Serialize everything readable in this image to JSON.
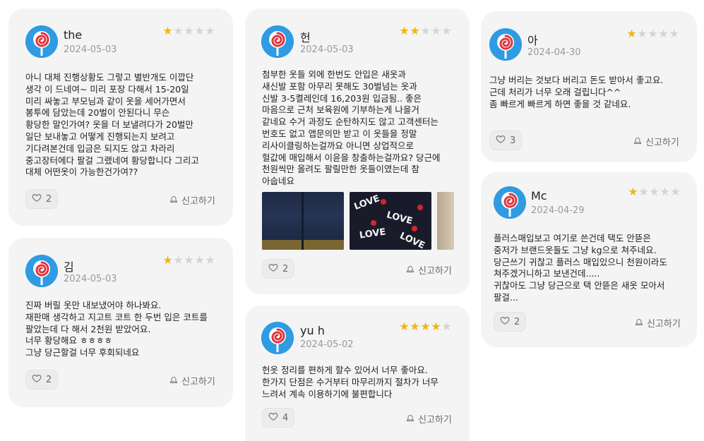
{
  "colors": {
    "accent_star": "#f2b611",
    "star_off": "#d4d4d4",
    "card_bg": "#f4f4f5",
    "avatar_bg": "#2e9be3"
  },
  "reviews": [
    {
      "user": "the",
      "date": "2024-05-03",
      "rating": 1,
      "text": "아니 대체 진행상황도 그렇고 별반개도 이깝단\n생각 이 드네여~ 미리 포장 다해서 15-20일\n미리 싸놓고 부모님과 같이 옷을 세어가면서\n봉투에 담았는데 20벌이 안된다니 무슨\n황당한 말인가여? 옷을 더 보낼려다가 20벌만\n일단 보내놓고 어떻게 진행되는지 보려고\n기다려본건데 입금은 되지도 않고 차라리\n중고장터에다 팔걸 그랬네여 황당합니다 그리고\n대체 어떤옷이 가능한건가여??",
      "likes": "2",
      "report": "신고하기"
    },
    {
      "user": "김",
      "date": "2024-05-03",
      "rating": 1,
      "text": "진짜 버릴 옷만 내보냈어야 하나봐요.\n재판매 생각하고 지고트 코트 한 두번 입은 코트를\n팔았는데 다 해서 2천원 받았어요.\n너무 황당해요 ㅎㅎㅎㅎ\n그냥 당근할걸 너무 후회되네요",
      "likes": "2",
      "report": "신고하기"
    },
    {
      "user": "헌",
      "date": "2024-05-03",
      "rating": 2,
      "text": "첨부한 옷들 외에 한번도 안입은 새옷과\n새신발 포함 아무리 못해도 30벌넘는 옷과\n신발 3-5켤레인데 16,203원 입금됨.. 좋은\n마음으로 근처 보육원에 기부하는게 나을거\n같네요 수거 과정도 순탄하지도 않고 고객센터는\n번호도 없고 앱문의만 받고 이 옷들을 정말\n리사이클링하는걸까요 아니면 상업적으로\n헐값에 매입해서 이윤을 창출하는걸까요? 당근에\n천원씩만 올려도 팔릴만한 옷들이였는데 참\n아숩네요",
      "likes": "2",
      "report": "신고하기",
      "photos": [
        "jeans-photo",
        "sweater-photo",
        "third-photo"
      ]
    },
    {
      "user": "yu h",
      "date": "2024-05-02",
      "rating": 4,
      "text": "헌옷 정리를 편하게 할수 있어서 너무 좋아요.\n한가지 단점은 수거부터 마무리까지 절차가 너무\n느려서 계속 이용하기에 불편합니다",
      "likes": "4",
      "report": "신고하기"
    },
    {
      "user": "아",
      "date": "2024-04-30",
      "rating": 1,
      "text": "그냥 버리는 것보다 버리고 돈도 받아서 좋고요.\n근데 처리가 너무 오래 걸립니다^^\n좀 빠르게 빠르게 하면 좋을 것 같네요.",
      "likes": "3",
      "report": "신고하기"
    },
    {
      "user": "Mc",
      "date": "2024-04-29",
      "rating": 1,
      "text": "플러스매입보고 여기로 쓴건데 택도 안뜯은\n중저가 브랜드옷들도 그냥 kg으로 쳐주네요.\n당근쓰기 귀찮고 플러스 매입있으니 천원이라도\n쳐주겠거니하고 보낸건데.....\n귀찮아도 그냥 당근으로 택 안뜯은 새옷 모아서\n팔걸...",
      "likes": "2",
      "report": "신고하기"
    }
  ],
  "photo_text": {
    "love": "LOVE"
  }
}
